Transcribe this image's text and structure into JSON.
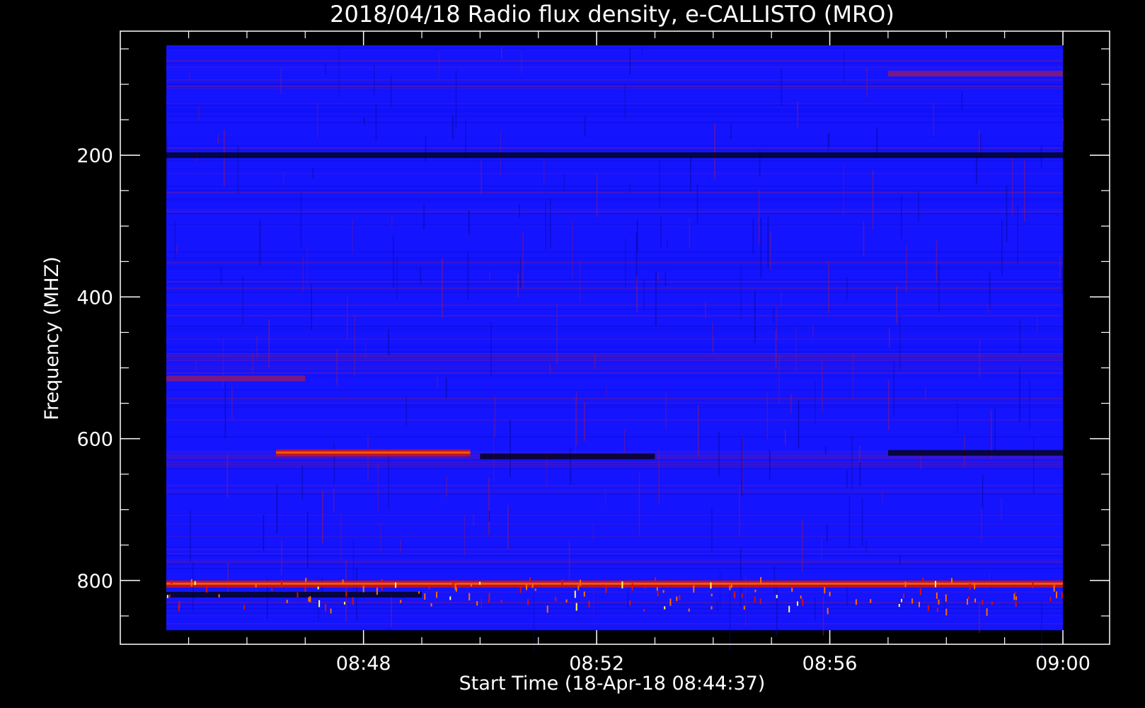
{
  "chart_data": {
    "type": "heatmap",
    "title": "2018/04/18  Radio flux density, e-CALLISTO (MRO)",
    "xlabel": "Start Time (18-Apr-18 08:44:37)",
    "ylabel": "Frequency (MHZ)",
    "x_unit": "time (UT, hh:mm)",
    "y_unit": "MHz",
    "xlim": [
      "08:44:37",
      "09:00:00"
    ],
    "ylim": [
      45,
      870
    ],
    "y_inverted": true,
    "x_ticks": [
      {
        "label": "08:48",
        "value": "08:48"
      },
      {
        "label": "08:52",
        "value": "08:52"
      },
      {
        "label": "08:56",
        "value": "08:56"
      },
      {
        "label": "09:00",
        "value": "09:00"
      }
    ],
    "y_ticks": [
      {
        "label": "200",
        "value": 200
      },
      {
        "label": "400",
        "value": 400
      },
      {
        "label": "600",
        "value": 600
      },
      {
        "label": "800",
        "value": 800
      }
    ],
    "grid": false,
    "colormap": [
      "#000000",
      "#1414ff",
      "#8a1a70",
      "#d41010",
      "#ff6a00",
      "#ffff60"
    ],
    "colors": {
      "background": "#000000",
      "frame": "#ffffff",
      "base_intensity": "#1414ff"
    },
    "features": [
      {
        "freq_mhz": 200,
        "t_start": "08:44:37",
        "t_end": "09:00:00",
        "level": "dark"
      },
      {
        "freq_mhz": 620,
        "t_start": "08:46:30",
        "t_end": "08:49:50",
        "level": "high"
      },
      {
        "freq_mhz": 625,
        "t_start": "08:50:00",
        "t_end": "08:53:00",
        "level": "dark"
      },
      {
        "freq_mhz": 620,
        "t_start": "08:57:00",
        "t_end": "09:00:00",
        "level": "dark"
      },
      {
        "freq_mhz": 515,
        "t_start": "08:44:37",
        "t_end": "08:47:00",
        "level": "medium"
      },
      {
        "freq_mhz": 85,
        "t_start": "08:57:00",
        "t_end": "09:00:00",
        "level": "medium"
      },
      {
        "freq_mhz": 805,
        "t_start": "08:44:37",
        "t_end": "09:00:00",
        "level": "high"
      },
      {
        "freq_mhz": 820,
        "t_start": "08:44:37",
        "t_end": "08:49:00",
        "level": "dark"
      }
    ]
  }
}
